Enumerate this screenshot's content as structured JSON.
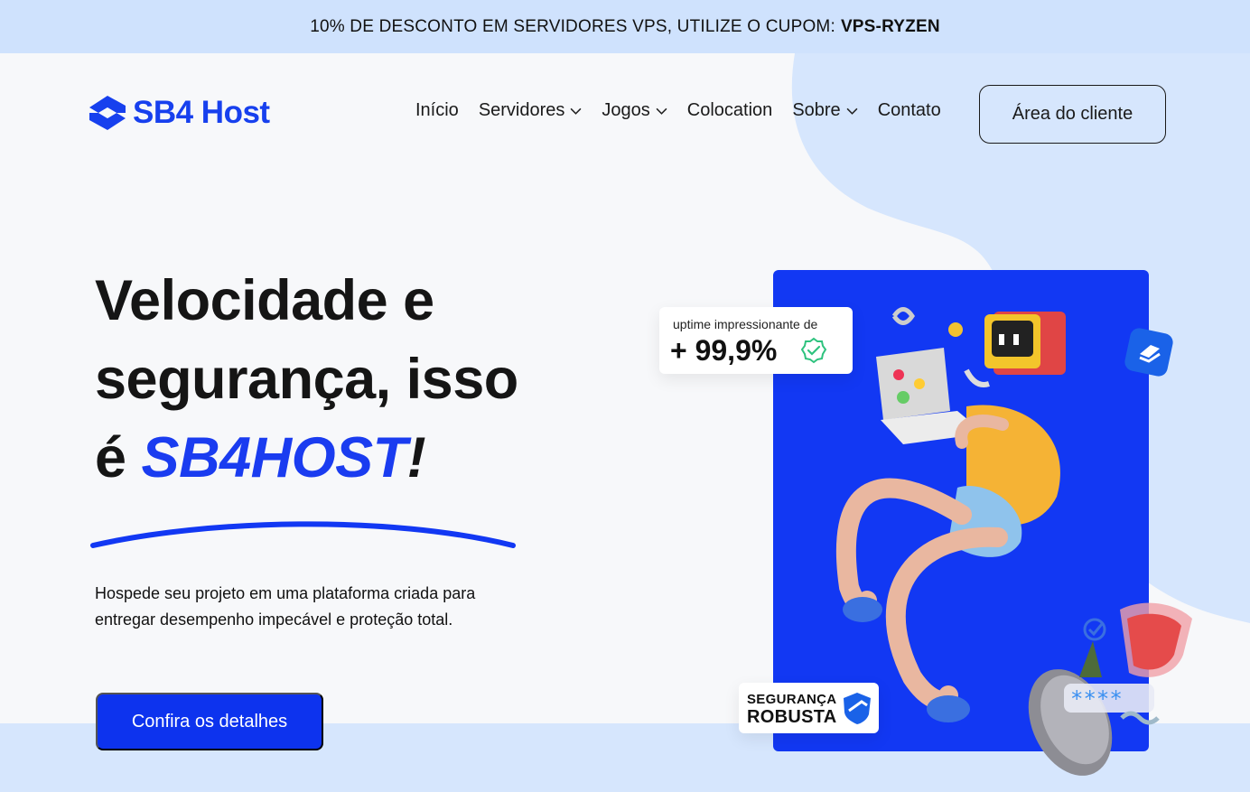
{
  "promo": {
    "text": "10% DE DESCONTO EM SERVIDORES VPS, UTILIZE O CUPOM:",
    "coupon": "VPS-RYZEN"
  },
  "brand": {
    "name": "SB4 Host",
    "logo_icon": "sb4-logo-icon",
    "accent_color": "#1a3cf0"
  },
  "nav": {
    "items": [
      {
        "label": "Início",
        "has_dropdown": false
      },
      {
        "label": "Servidores",
        "has_dropdown": true
      },
      {
        "label": "Jogos",
        "has_dropdown": true
      },
      {
        "label": "Colocation",
        "has_dropdown": false
      },
      {
        "label": "Sobre",
        "has_dropdown": true
      },
      {
        "label": "Contato",
        "has_dropdown": false
      }
    ],
    "client_button": "Área do cliente"
  },
  "hero": {
    "title_line1": "Velocidade e",
    "title_line2": "segurança, isso",
    "title_line3_prefix": "é ",
    "title_brand": "SB4HOST",
    "title_suffix": "!",
    "description": "Hospede seu projeto em uma plataforma criada para entregar desempenho impecável e proteção total.",
    "cta": "Confira os detalhes"
  },
  "uptime_badge": {
    "label": "uptime impressionante de",
    "value": "+ 99,9%",
    "icon": "verified-check-icon"
  },
  "security_badge": {
    "line1": "SEGURANÇA",
    "line2": "ROBUSTA",
    "icon": "shield-icon"
  },
  "illustration": {
    "password_mask": "****"
  }
}
